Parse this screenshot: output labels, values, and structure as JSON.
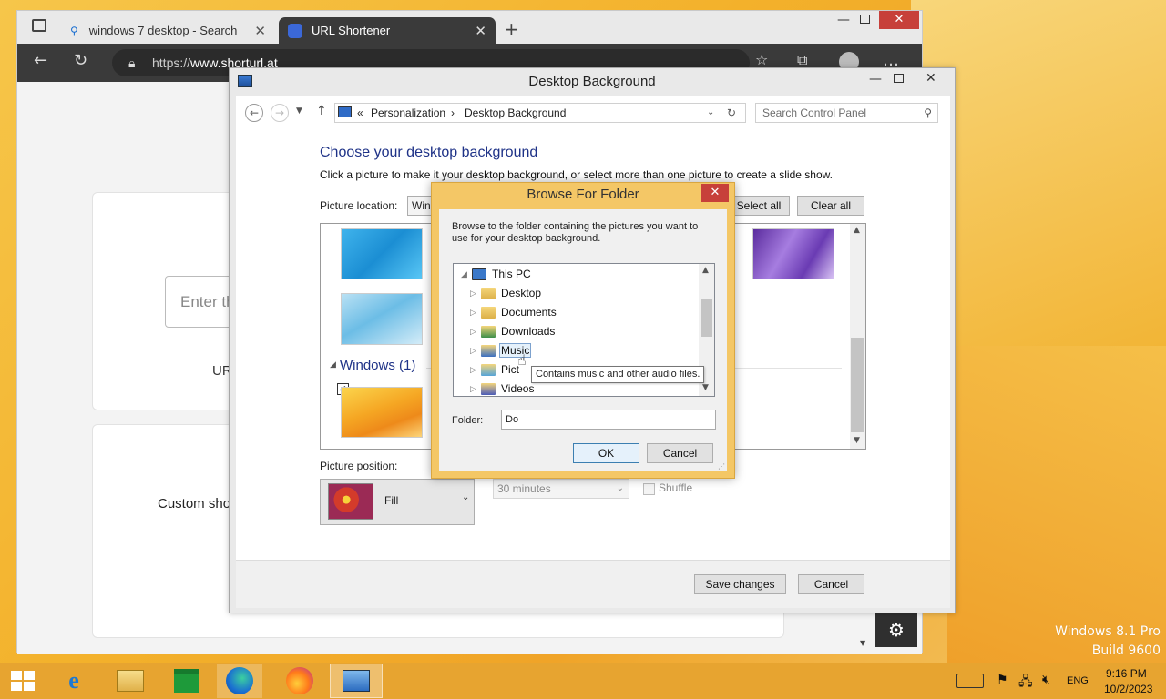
{
  "desktop": {
    "watermark_line1": "Windows 8.1 Pro",
    "watermark_line2": "Build 9600"
  },
  "browser": {
    "tabs": [
      {
        "label": "windows 7 desktop - Search",
        "icon": "search-icon"
      },
      {
        "label": "URL Shortener",
        "icon": "page-icon"
      }
    ],
    "address_prefix": "https://",
    "address_domain": "www.shorturl.at",
    "page": {
      "input_placeholder": "Enter th",
      "ur_label": "UR",
      "custom_label": "Custom sho"
    }
  },
  "control_panel": {
    "title": "Desktop Background",
    "breadcrumb_sep": "«",
    "breadcrumb": [
      "Personalization",
      "Desktop Background"
    ],
    "search_placeholder": "Search Control Panel",
    "heading": "Choose your desktop background",
    "subtitle": "Click a picture to make it your desktop background, or select more than one picture to create a slide show.",
    "picture_location_label": "Picture location:",
    "picture_location_value": "Wind",
    "select_all": "Select all",
    "clear_all": "Clear all",
    "group_label": "Windows (1)",
    "picture_position_label": "Picture position:",
    "picture_position_value": "Fill",
    "interval_value": "30 minutes",
    "shuffle_label": "Shuffle",
    "save_changes": "Save changes",
    "cancel": "Cancel"
  },
  "dialog": {
    "title": "Browse For Folder",
    "instruction": "Browse to the folder containing the pictures you want to use for your desktop background.",
    "tree": [
      {
        "label": "This PC",
        "expanded": true
      },
      {
        "label": "Desktop"
      },
      {
        "label": "Documents"
      },
      {
        "label": "Downloads"
      },
      {
        "label": "Music",
        "selected": true
      },
      {
        "label": "Pict"
      },
      {
        "label": "Videos"
      }
    ],
    "tooltip": "Contains music and other audio files.",
    "folder_label": "Folder:",
    "folder_value": "Do",
    "ok": "OK",
    "cancel": "Cancel"
  },
  "taskbar": {
    "apps": [
      "internet-explorer-icon",
      "file-explorer-icon",
      "store-icon",
      "edge-icon",
      "firefox-icon",
      "control-panel-icon"
    ],
    "language": "ENG",
    "time": "9:16 PM",
    "date": "10/2/2023"
  }
}
